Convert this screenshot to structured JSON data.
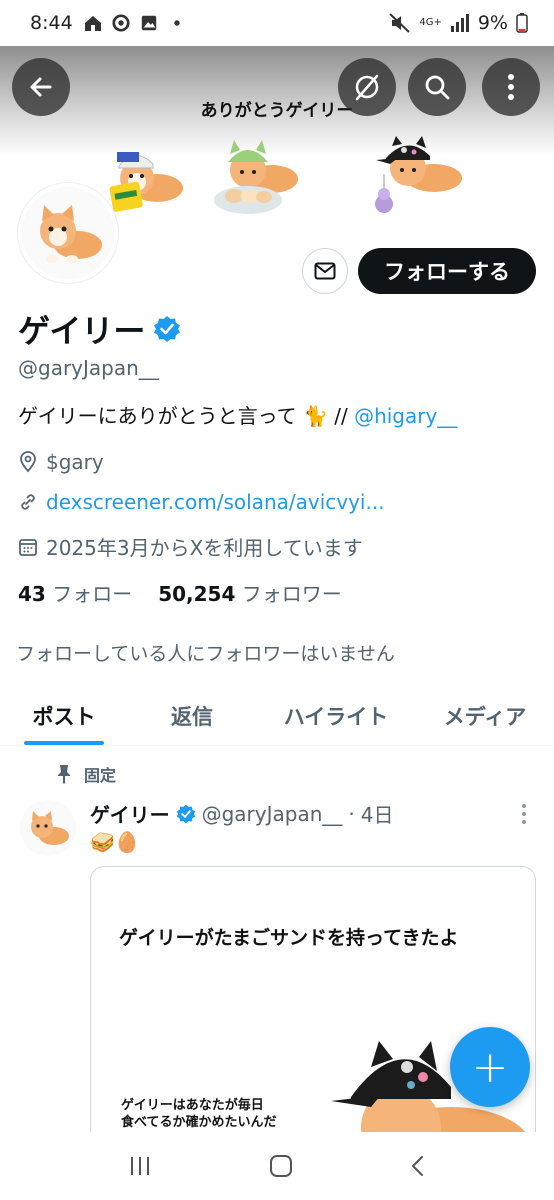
{
  "status_bar": {
    "time": "8:44",
    "network": "4G+",
    "battery": "9%",
    "left_icons": [
      "home-icon",
      "chrome-icon",
      "gallery-icon",
      "dot-icon"
    ],
    "right_icons": [
      "mute-icon",
      "signal-icon",
      "battery-icon"
    ]
  },
  "header": {
    "banner_text": "ありがとうゲイリー",
    "back_icon": "back-arrow-icon",
    "grok_icon": "slash-circle-icon",
    "search_icon": "search-icon",
    "more_icon": "more-vertical-icon"
  },
  "profile": {
    "name": "ゲイリー",
    "verified": true,
    "handle": "@garyJapan__",
    "bio_text": "ゲイリーにありがとうと言って 🐈 // ",
    "bio_link": "@higary__",
    "location": "$gary",
    "website": "dexscreener.com/solana/avicvyi...",
    "joined": "2025年3月からXを利用しています",
    "following_count": "43",
    "following_label": "フォロー",
    "followers_count": "50,254",
    "followers_label": "フォロワー",
    "no_followers_note": "フォローしている人にフォロワーはいません",
    "follow_button": "フォローする"
  },
  "tabs": [
    {
      "label": "ポスト",
      "active": true
    },
    {
      "label": "返信",
      "active": false
    },
    {
      "label": "ハイライト",
      "active": false
    },
    {
      "label": "メディア",
      "active": false
    }
  ],
  "pinned_post": {
    "pinned_label": "固定",
    "author": "ゲイリー",
    "handle": "@garyJapan__",
    "separator": "·",
    "time": "4日",
    "text": "🥪🥚",
    "card_title": "ゲイリーがたまごサンドを持ってきたよ",
    "card_subtitle_1": "ゲイリーはあなたが毎日",
    "card_subtitle_2": "食べてるか確かめたいんだ"
  },
  "fab_label": "+",
  "colors": {
    "accent": "#1d9bf0",
    "text": "#0f1419",
    "muted": "#536471",
    "button_dark": "#0f1419",
    "kitten": "#f0a060"
  }
}
